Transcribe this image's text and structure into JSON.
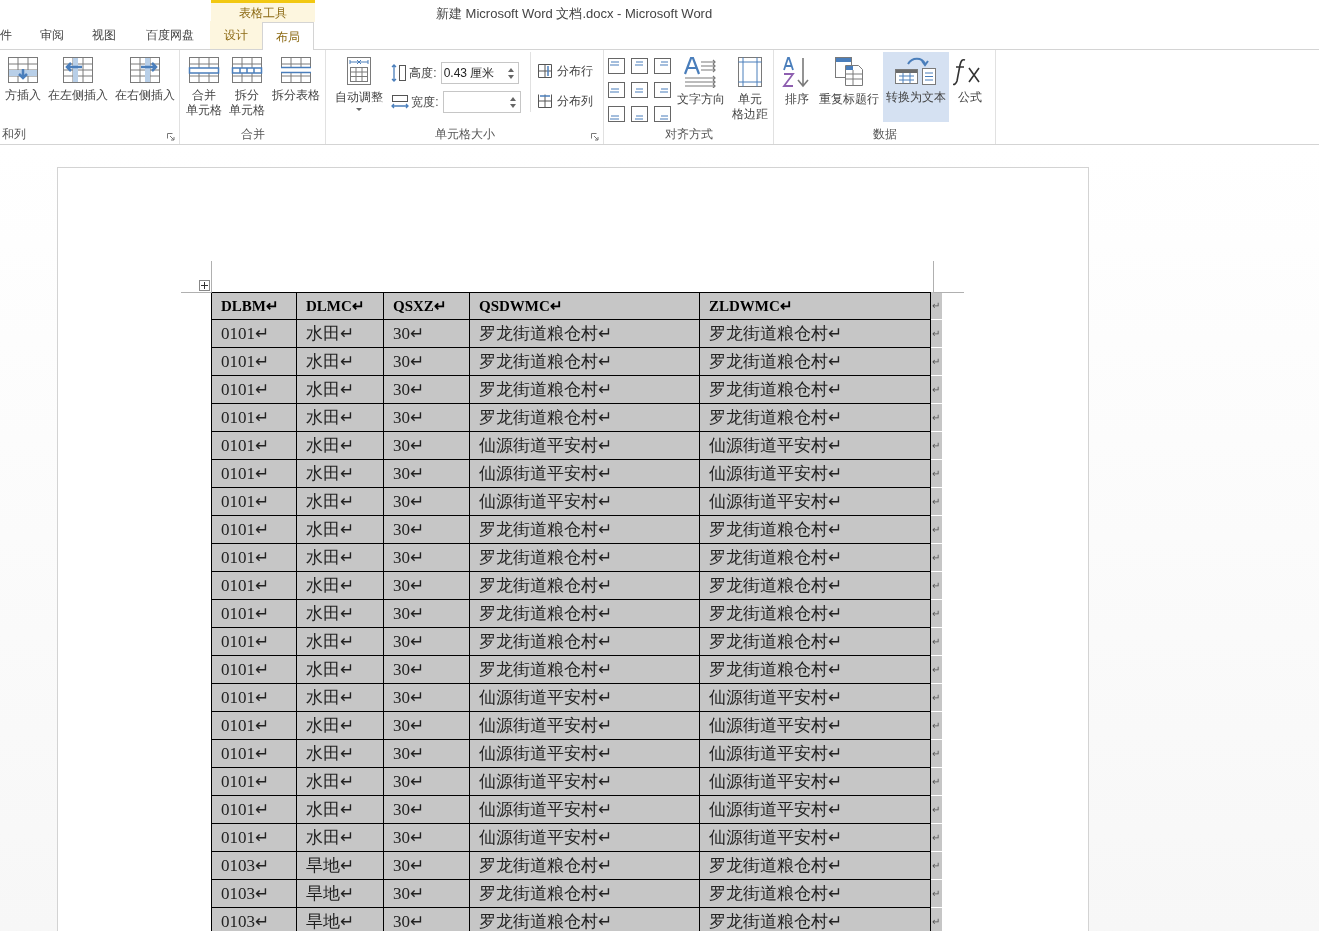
{
  "window": {
    "title": "新建 Microsoft Word 文档.docx - Microsoft Word"
  },
  "context_tab_group": {
    "label": "表格工具"
  },
  "tabs": [
    {
      "label": "件",
      "selected": false,
      "context": false
    },
    {
      "label": "审阅",
      "selected": false,
      "context": false
    },
    {
      "label": "视图",
      "selected": false,
      "context": false
    },
    {
      "label": "百度网盘",
      "selected": false,
      "context": false
    },
    {
      "label": "设计",
      "selected": false,
      "context": true
    },
    {
      "label": "布局",
      "selected": true,
      "context": true
    }
  ],
  "ribbon": [
    {
      "label": "和列",
      "launcher": true,
      "items": [
        {
          "kind": "large",
          "lines": [
            "方插入"
          ],
          "highlighted": false
        },
        {
          "kind": "large",
          "lines": [
            "在左侧插入"
          ],
          "highlighted": false
        },
        {
          "kind": "large",
          "lines": [
            "在右侧插入"
          ],
          "highlighted": false
        }
      ]
    },
    {
      "label": "合并",
      "launcher": false,
      "items": [
        {
          "kind": "large",
          "lines": [
            "合并",
            "单元格"
          ],
          "highlighted": false
        },
        {
          "kind": "large",
          "lines": [
            "拆分",
            "单元格"
          ],
          "highlighted": false
        },
        {
          "kind": "large",
          "lines": [
            "拆分表格"
          ],
          "highlighted": false
        }
      ]
    },
    {
      "label": "单元格大小",
      "launcher": true,
      "items": [
        {
          "kind": "large",
          "lines": [
            "自动调整"
          ],
          "dropdown": true,
          "highlighted": false
        },
        {
          "kind": "fields",
          "fields": [
            {
              "label": "高度:",
              "value": "0.43 厘米"
            },
            {
              "label": "宽度:"
            }
          ],
          "highlighted": false
        },
        {
          "kind": "small-stack",
          "buttons": [
            {
              "label": "分布行"
            },
            {
              "label": "分布列"
            }
          ],
          "highlighted": false
        }
      ]
    },
    {
      "label": "对齐方式",
      "launcher": false,
      "items": [
        {
          "kind": "align",
          "highlighted": false
        },
        {
          "kind": "large",
          "lines": [
            "文字方向"
          ],
          "highlighted": false
        },
        {
          "kind": "large",
          "lines": [
            "单元",
            "格边距"
          ],
          "highlighted": false
        }
      ]
    },
    {
      "label": "数据",
      "launcher": false,
      "items": [
        {
          "kind": "large",
          "lines": [
            "排序"
          ],
          "highlighted": false
        },
        {
          "kind": "large",
          "lines": [
            "重复标题行"
          ],
          "highlighted": false
        },
        {
          "kind": "large",
          "lines": [
            "转换为文本"
          ],
          "highlighted": true
        },
        {
          "kind": "large",
          "lines": [
            "公式"
          ],
          "highlighted": false
        }
      ]
    }
  ],
  "table": {
    "columns": [
      "DLBM↵",
      "DLMC↵",
      "QSXZ↵",
      "QSDWMC↵",
      "ZLDWMC↵"
    ],
    "header_end": "↵",
    "rows": [
      {
        "cells": [
          "0101↵",
          "水田↵",
          "30↵",
          "罗龙街道粮仓村↵",
          "罗龙街道粮仓村↵"
        ],
        "end": "↵"
      },
      {
        "cells": [
          "0101↵",
          "水田↵",
          "30↵",
          "罗龙街道粮仓村↵",
          "罗龙街道粮仓村↵"
        ],
        "end": "↵"
      },
      {
        "cells": [
          "0101↵",
          "水田↵",
          "30↵",
          "罗龙街道粮仓村↵",
          "罗龙街道粮仓村↵"
        ],
        "end": "↵"
      },
      {
        "cells": [
          "0101↵",
          "水田↵",
          "30↵",
          "罗龙街道粮仓村↵",
          "罗龙街道粮仓村↵"
        ],
        "end": "↵"
      },
      {
        "cells": [
          "0101↵",
          "水田↵",
          "30↵",
          "仙源街道平安村↵",
          "仙源街道平安村↵"
        ],
        "end": "↵"
      },
      {
        "cells": [
          "0101↵",
          "水田↵",
          "30↵",
          "仙源街道平安村↵",
          "仙源街道平安村↵"
        ],
        "end": "↵"
      },
      {
        "cells": [
          "0101↵",
          "水田↵",
          "30↵",
          "仙源街道平安村↵",
          "仙源街道平安村↵"
        ],
        "end": "↵"
      },
      {
        "cells": [
          "0101↵",
          "水田↵",
          "30↵",
          "罗龙街道粮仓村↵",
          "罗龙街道粮仓村↵"
        ],
        "end": "↵"
      },
      {
        "cells": [
          "0101↵",
          "水田↵",
          "30↵",
          "罗龙街道粮仓村↵",
          "罗龙街道粮仓村↵"
        ],
        "end": "↵"
      },
      {
        "cells": [
          "0101↵",
          "水田↵",
          "30↵",
          "罗龙街道粮仓村↵",
          "罗龙街道粮仓村↵"
        ],
        "end": "↵"
      },
      {
        "cells": [
          "0101↵",
          "水田↵",
          "30↵",
          "罗龙街道粮仓村↵",
          "罗龙街道粮仓村↵"
        ],
        "end": "↵"
      },
      {
        "cells": [
          "0101↵",
          "水田↵",
          "30↵",
          "罗龙街道粮仓村↵",
          "罗龙街道粮仓村↵"
        ],
        "end": "↵"
      },
      {
        "cells": [
          "0101↵",
          "水田↵",
          "30↵",
          "罗龙街道粮仓村↵",
          "罗龙街道粮仓村↵"
        ],
        "end": "↵"
      },
      {
        "cells": [
          "0101↵",
          "水田↵",
          "30↵",
          "仙源街道平安村↵",
          "仙源街道平安村↵"
        ],
        "end": "↵"
      },
      {
        "cells": [
          "0101↵",
          "水田↵",
          "30↵",
          "仙源街道平安村↵",
          "仙源街道平安村↵"
        ],
        "end": "↵"
      },
      {
        "cells": [
          "0101↵",
          "水田↵",
          "30↵",
          "仙源街道平安村↵",
          "仙源街道平安村↵"
        ],
        "end": "↵"
      },
      {
        "cells": [
          "0101↵",
          "水田↵",
          "30↵",
          "仙源街道平安村↵",
          "仙源街道平安村↵"
        ],
        "end": "↵"
      },
      {
        "cells": [
          "0101↵",
          "水田↵",
          "30↵",
          "仙源街道平安村↵",
          "仙源街道平安村↵"
        ],
        "end": "↵"
      },
      {
        "cells": [
          "0101↵",
          "水田↵",
          "30↵",
          "仙源街道平安村↵",
          "仙源街道平安村↵"
        ],
        "end": "↵"
      },
      {
        "cells": [
          "0103↵",
          "旱地↵",
          "30↵",
          "罗龙街道粮仓村↵",
          "罗龙街道粮仓村↵"
        ],
        "end": "↵"
      },
      {
        "cells": [
          "0103↵",
          "旱地↵",
          "30↵",
          "罗龙街道粮仓村↵",
          "罗龙街道粮仓村↵"
        ],
        "end": "↵"
      },
      {
        "cells": [
          "0103↵",
          "旱地↵",
          "30↵",
          "罗龙街道粮仓村↵",
          "罗龙街道粮仓村↵"
        ],
        "end": "↵"
      }
    ]
  }
}
